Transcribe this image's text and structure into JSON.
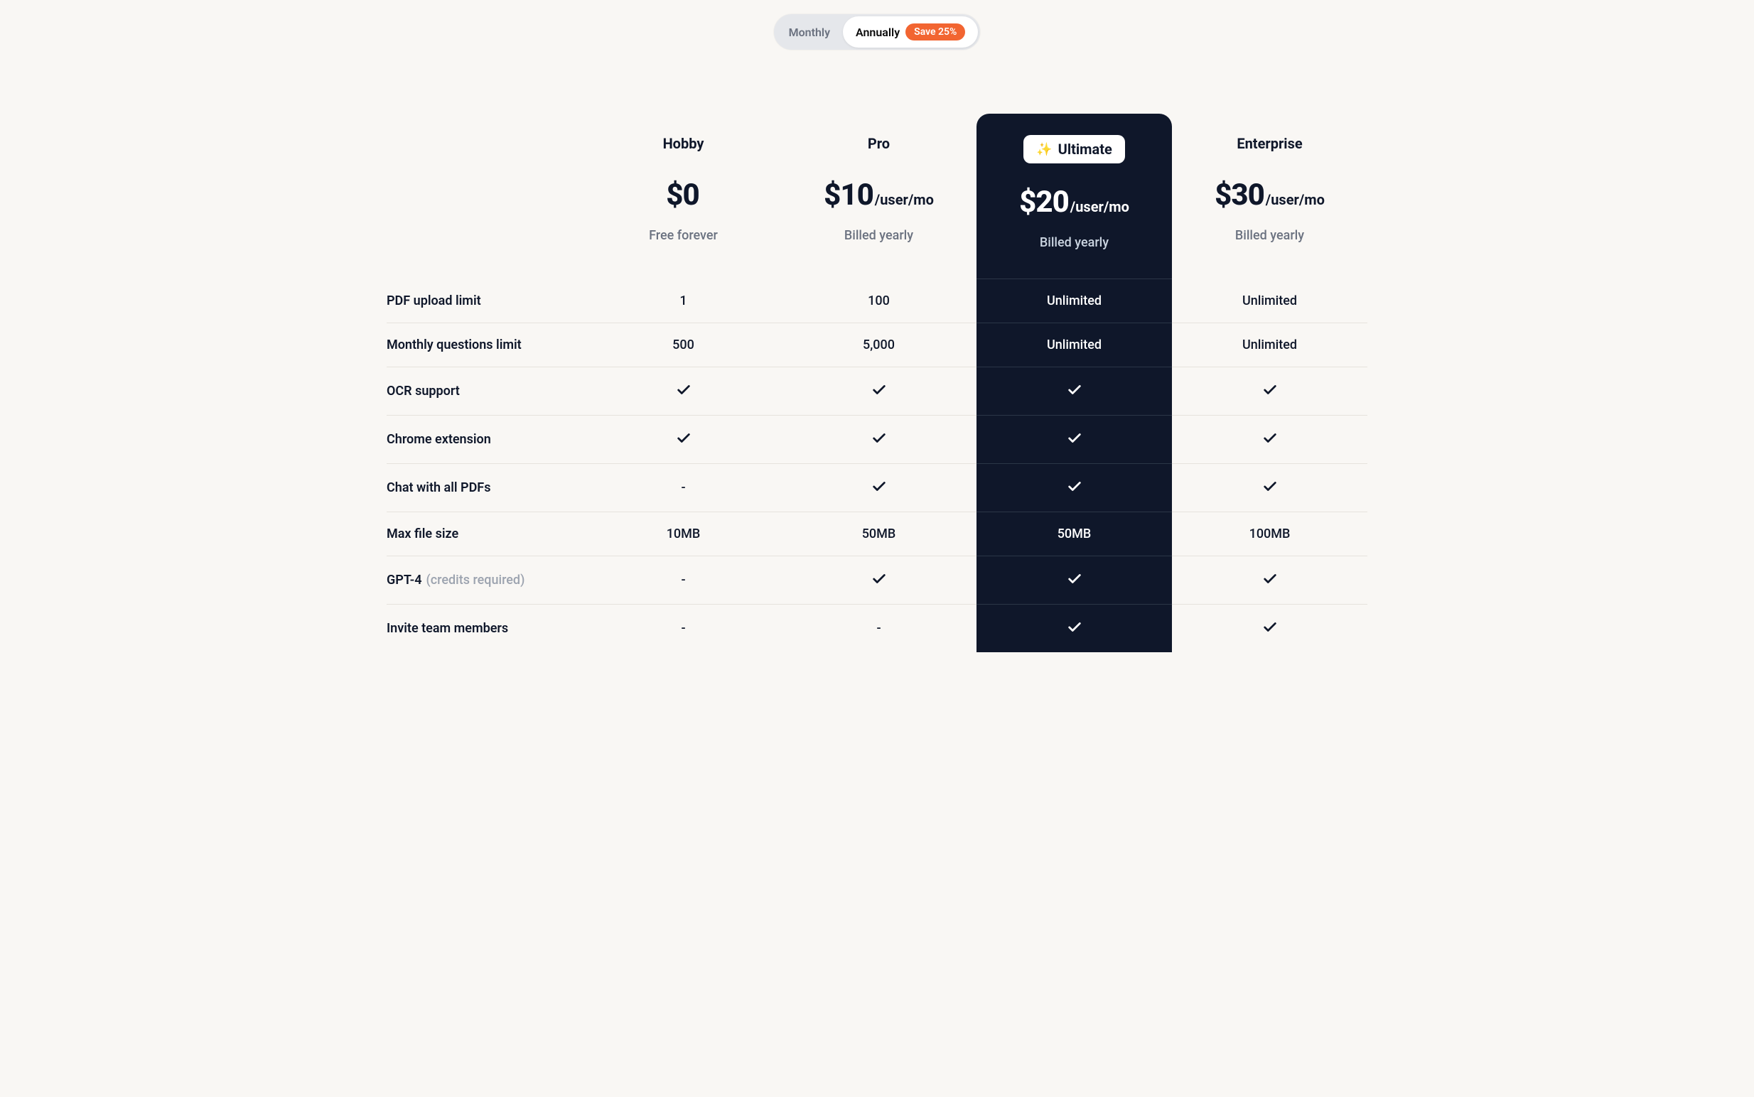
{
  "billing_toggle": {
    "monthly": "Monthly",
    "annually": "Annually",
    "save_badge": "Save 25%"
  },
  "plans": {
    "hobby": {
      "name": "Hobby",
      "price": "$0",
      "per": "",
      "note": "Free forever"
    },
    "pro": {
      "name": "Pro",
      "price": "$10",
      "per": "/user/mo",
      "note": "Billed yearly"
    },
    "ultimate": {
      "name": "Ultimate",
      "price": "$20",
      "per": "/user/mo",
      "note": "Billed yearly"
    },
    "enterprise": {
      "name": "Enterprise",
      "price": "$30",
      "per": "/user/mo",
      "note": "Billed yearly"
    }
  },
  "features": [
    {
      "label": "PDF upload limit",
      "sub": "",
      "hobby": "1",
      "pro": "100",
      "ultimate": "Unlimited",
      "enterprise": "Unlimited"
    },
    {
      "label": "Monthly questions limit",
      "sub": "",
      "hobby": "500",
      "pro": "5,000",
      "ultimate": "Unlimited",
      "enterprise": "Unlimited"
    },
    {
      "label": "OCR support",
      "sub": "",
      "hobby": "check",
      "pro": "check",
      "ultimate": "check",
      "enterprise": "check"
    },
    {
      "label": "Chrome extension",
      "sub": "",
      "hobby": "check",
      "pro": "check",
      "ultimate": "check",
      "enterprise": "check"
    },
    {
      "label": "Chat with all PDFs",
      "sub": "",
      "hobby": "-",
      "pro": "check",
      "ultimate": "check",
      "enterprise": "check"
    },
    {
      "label": "Max file size",
      "sub": "",
      "hobby": "10MB",
      "pro": "50MB",
      "ultimate": "50MB",
      "enterprise": "100MB"
    },
    {
      "label": "GPT-4",
      "sub": "(credits required)",
      "hobby": "-",
      "pro": "check",
      "ultimate": "check",
      "enterprise": "check"
    },
    {
      "label": "Invite team members",
      "sub": "",
      "hobby": "-",
      "pro": "-",
      "ultimate": "check",
      "enterprise": "check"
    }
  ]
}
